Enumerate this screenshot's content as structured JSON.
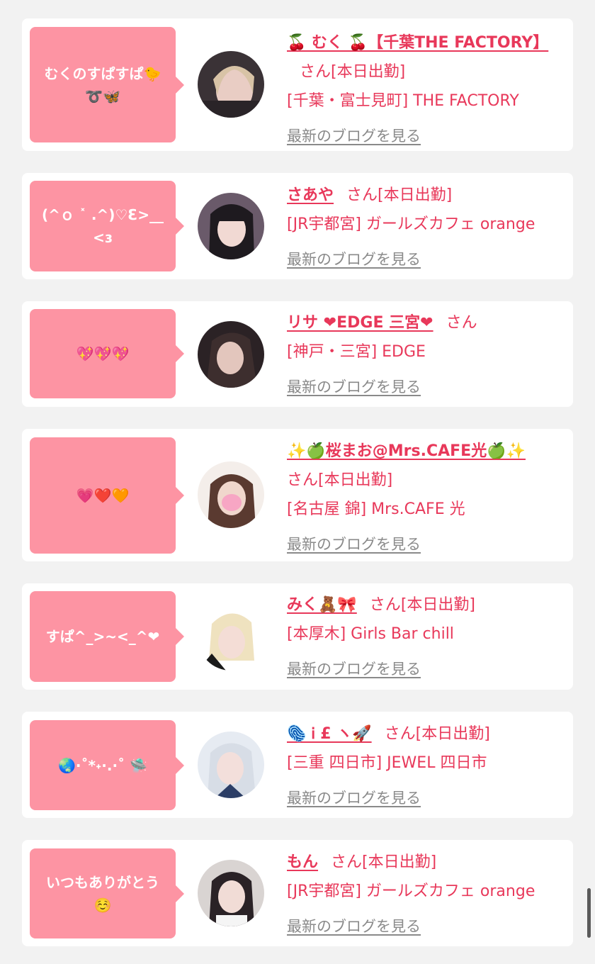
{
  "posts": [
    {
      "message": "むくのすぱすぱ🐤➰🦋",
      "name": "🍒 むく 🍒【千葉THE FACTORY】",
      "san": "さん",
      "status": "[本日出勤]",
      "shop": "[千葉・富士見町] THE FACTORY",
      "blog_link": "最新のブログを見る"
    },
    {
      "message": "(^ｏ ˟ .^)♡Ɛ>__<ɜ",
      "name": "さあや",
      "san": "さん",
      "status": "[本日出勤]",
      "shop": "[JR宇都宮] ガールズカフェ orange",
      "blog_link": "最新のブログを見る"
    },
    {
      "message": "💖💖💖",
      "name": "リサ ❤EDGE 三宮❤",
      "san": "さん",
      "status": "",
      "shop": "[神戸・三宮] EDGE",
      "blog_link": "最新のブログを見る"
    },
    {
      "message": "💗❤️🧡",
      "name": "✨🍏桜まお@Mrs.CAFE光🍏✨",
      "san": "さん",
      "status": "[本日出勤]",
      "shop": "[名古屋 錦] Mrs.CAFE 光",
      "blog_link": "最新のブログを見る"
    },
    {
      "message": "すぱ^_>~<_^❤",
      "name": "みく🧸🎀",
      "san": "さん",
      "status": "[本日出勤]",
      "shop": "[本厚木] Girls Bar chill",
      "blog_link": "最新のブログを見る"
    },
    {
      "message": "🌏·˚*˖·.·˚ 🛸",
      "name": "🫆 Ꭵ £ ヽ🚀",
      "san": "さん",
      "status": "[本日出勤]",
      "shop": "[三重 四日市] JEWEL 四日市",
      "blog_link": "最新のブログを見る"
    },
    {
      "message": "いつもありがとう☺️",
      "name": "もん",
      "san": "さん",
      "status": "[本日出勤]",
      "shop": "[JR宇都宮] ガールズカフェ orange",
      "blog_link": "最新のブログを見る"
    }
  ],
  "colors": {
    "accent": "#e8385a",
    "bubble": "#fd94a3",
    "background": "#f2f2f2",
    "card": "#ffffff",
    "link_gray": "#8a8a8a"
  }
}
